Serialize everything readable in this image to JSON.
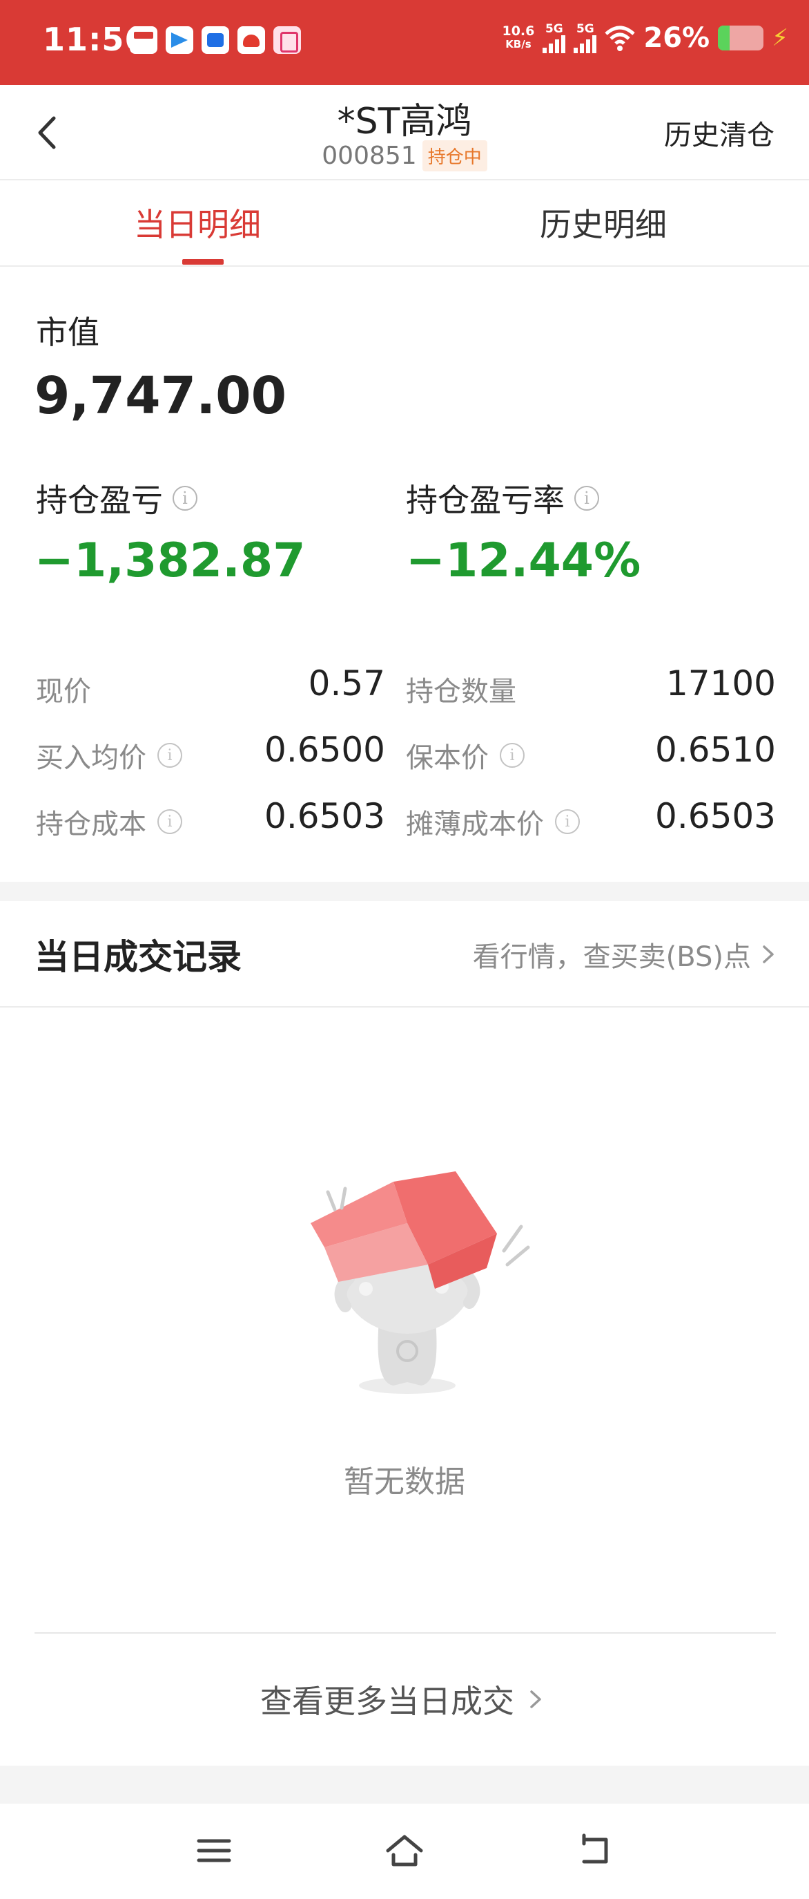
{
  "status_bar": {
    "time": "11:56",
    "net_speed_value": "10.6",
    "net_speed_unit": "KB/s",
    "sim1_label": "5G",
    "sim2_label": "5G",
    "battery_pct": "26%",
    "battery_level": 0.26,
    "colors": {
      "bar_bg": "#d93a35",
      "battery_fill": "#5bd35b",
      "bolt": "#f7d234"
    }
  },
  "header": {
    "title": "*ST高鸿",
    "code": "000851",
    "badge": "持仓中",
    "right_action": "历史清仓"
  },
  "tabs": [
    {
      "label": "当日明细",
      "active": true
    },
    {
      "label": "历史明细",
      "active": false
    }
  ],
  "summary": {
    "market_value_label": "市值",
    "market_value": "9,747.00",
    "pl_label": "持仓盈亏",
    "pl_value": "−1,382.87",
    "pl_rate_label": "持仓盈亏率",
    "pl_rate_value": "−12.44%",
    "loss_color": "#1f9a2f"
  },
  "details": [
    {
      "label": "现价",
      "value": "0.57",
      "info": false
    },
    {
      "label": "持仓数量",
      "value": "17100",
      "info": false
    },
    {
      "label": "买入均价",
      "value": "0.6500",
      "info": true
    },
    {
      "label": "保本价",
      "value": "0.6510",
      "info": true
    },
    {
      "label": "持仓成本",
      "value": "0.6503",
      "info": true
    },
    {
      "label": "摊薄成本价",
      "value": "0.6503",
      "info": true
    }
  ],
  "trades_section": {
    "title": "当日成交记录",
    "link": "看行情，查买卖(BS)点",
    "empty_text": "暂无数据",
    "more_link": "查看更多当日成交"
  },
  "accent_color": "#d93a35"
}
